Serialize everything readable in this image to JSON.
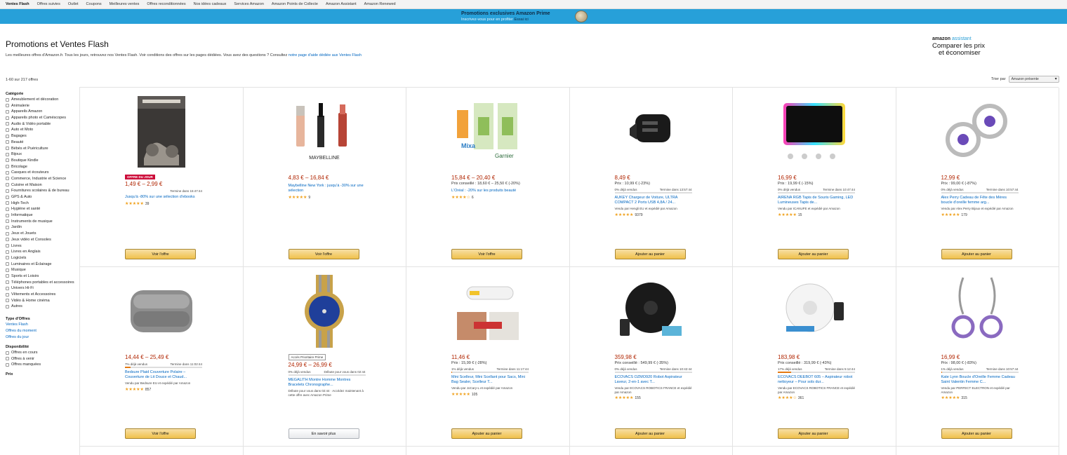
{
  "nav": {
    "items": [
      "Ventes Flash",
      "Offres suivies",
      "Outlet",
      "Coupons",
      "Meilleures ventes",
      "Offres reconditionnées",
      "Nos idées cadeaux",
      "Services Amazon",
      "Amazon Points de Collecte",
      "Amazon Assistant",
      "Amazon Renewed"
    ],
    "active_index": 0
  },
  "banner": {
    "title": "Promotions exclusives Amazon Prime",
    "subtitle": "Inscrivez-vous pour en profiter",
    "subtitle_link": "Essai ici",
    "bg_color": "#27a0d9"
  },
  "header": {
    "title": "Promotions et Ventes Flash",
    "description": "Les meilleures offres d'Amazon.fr. Tous les jours, retrouvez nos Ventes Flash. Voir conditions des offres sur les pages dédiées. Vous avez des questions ? Consultez",
    "description_link": "notre page d'aide dédiée aux Ventes Flash"
  },
  "assistant": {
    "logo_prefix": "amazon",
    "logo_suffix": "assistant",
    "line1": "Comparer les prix",
    "line2": "et économiser"
  },
  "results": {
    "count": "1-60 sur 217 offres"
  },
  "sort": {
    "label": "Trier par",
    "selected": "Amazon présente"
  },
  "sidebar": {
    "category_title": "Catégorie",
    "categories": [
      "Ameublement et décoration",
      "Animalerie",
      "Appareils Amazon",
      "Appareils photo et Caméscopes",
      "Audio & Vidéo portable",
      "Auto et Moto",
      "Bagages",
      "Beauté",
      "Bébés et Puériculture",
      "Bijoux",
      "Boutique Kindle",
      "Bricolage",
      "Casques et écouteurs",
      "Commerce, Industrie et Science",
      "Cuisine et Maison",
      "Fournitures scolaires & de bureau",
      "GPS & Auto",
      "High-Tech",
      "Hygiène et santé",
      "Informatique",
      "Instruments de musique",
      "Jardin",
      "Jeux et Jouets",
      "Jeux vidéo et Consoles",
      "Livres",
      "Livres en Anglais",
      "Logiciels",
      "Luminaires et Éclairage",
      "Musique",
      "Sports et Loisirs",
      "Téléphones portables et accessoires",
      "Univers Hi-Fi",
      "Vêtements et Accessoires",
      "Vidéo & Home cinéma",
      "Autres"
    ],
    "type_title": "Type d'Offres",
    "types": [
      "Ventes Flash",
      "Offres du moment",
      "Offres du jour"
    ],
    "availability_title": "Disponibilité",
    "availability": [
      "Offres en cours",
      "Offres à venir",
      "Offres manquées"
    ],
    "price_title": "Prix"
  },
  "products": [
    {
      "badge": "OFFRE DU JOUR",
      "price": "1,49 € – 2,99 €",
      "ref": "",
      "meta_left": "",
      "meta_right": "Termine dans 15:47:44",
      "claimed": null,
      "title": "Jusqu'à -80% sur une sélection d'ebooks",
      "seller": "",
      "stars": "★★★★★",
      "reviews": "39",
      "button": "Voir l'offre",
      "button_style": "yellow",
      "image": "book-icon"
    },
    {
      "badge": "",
      "price": "4,83 € – 16,84 €",
      "ref": "",
      "meta_left": "",
      "meta_right": "",
      "claimed": null,
      "title": "Maybelline New York : jusqu'à -30% sur une sélection",
      "seller": "",
      "stars": "★★★★★",
      "reviews": "9",
      "button": "Voir l'offre",
      "button_style": "yellow",
      "image": "makeup-icon"
    },
    {
      "badge": "",
      "price": "15,84 € – 20,40 €",
      "ref": "Prix conseillé : 18,60 € – 25,50 € (-20%)",
      "meta_left": "",
      "meta_right": "",
      "claimed": null,
      "title": "L'Oréal : -20% sur les produits beauté",
      "seller": "",
      "stars": "★★★★☆",
      "reviews": "6",
      "button": "Voir l'offre",
      "button_style": "yellow",
      "image": "cosmetics-icon"
    },
    {
      "badge": "",
      "price": "8,49 €",
      "ref": "Prix : 10,99 € (-23%)",
      "meta_left": "0% déjà vendus",
      "meta_right": "Termine dans 13:57:44",
      "claimed": 0,
      "title": "AUKEY Chargeur de Voiture, ULTRA COMPACT 2 Ports USB 4,8A / 24...",
      "seller": "Vendu par Hengli EU et expédié par Amazon",
      "stars": "★★★★★",
      "reviews": "9379",
      "button": "Ajouter au panier",
      "button_style": "yellow",
      "image": "car-charger-icon"
    },
    {
      "badge": "",
      "price": "16,99 €",
      "ref": "Prix : 19,99 € (-15%)",
      "meta_left": "0% déjà vendus",
      "meta_right": "Termine dans 10:47:44",
      "claimed": 0,
      "title": "AIRENA RGB Tapis de Souris Gaming, LED Lumineuses Tapis de...",
      "seller": "Vendu par ICANUFE et expédié par Amazon",
      "stars": "★★★★★",
      "reviews": "15",
      "button": "Ajouter au panier",
      "button_style": "yellow",
      "image": "mousepad-icon"
    },
    {
      "badge": "",
      "price": "12,99 €",
      "ref": "Prix : 99,00 € (-87%)",
      "meta_left": "0% déjà vendus",
      "meta_right": "Termine dans 10:57:44",
      "claimed": 0,
      "title": "Alex Perry Cadeau de Fête des Mères boucle d'oreille femme arg...",
      "seller": "Vendu par Alex Perry Bijoux et expédié par Amazon",
      "stars": "★★★★★",
      "reviews": "179",
      "button": "Ajouter au panier",
      "button_style": "yellow",
      "image": "earrings-icon"
    },
    {
      "badge": "",
      "price": "14,44 € – 25,49 €",
      "ref": "",
      "meta_left": "7% déjà vendus",
      "meta_right": "Termine dans 11:02:44",
      "claimed": 7,
      "title": "Bedsure Plaid Couverture Polaire – Couverture de Lit Douce et Chaud...",
      "seller": "Vendu par Bedsure EU et expédié par Amazon",
      "stars": "★★★★★",
      "reviews": "857",
      "button": "Voir l'offre",
      "button_style": "yellow",
      "image": "blanket-icon"
    },
    {
      "badge": "Accès Prioritaire Prime",
      "price": "24,99 € – 26,99 €",
      "ref": "",
      "meta_left": "0% déjà vendus",
      "meta_right": "Débute pour vous dans 02:44",
      "claimed": 0,
      "title": "MEGALITH Montre Homme Montres Bracelets Chronographe...",
      "seller": "Débute pour vous dans 02:44 · Accédez maintenant à cette offre avec Amazon Prime",
      "stars": "",
      "reviews": "",
      "button": "En savoir plus",
      "button_style": "white",
      "image": "watch-icon"
    },
    {
      "badge": "",
      "price": "11,46 €",
      "ref": "Prix : 15,99 € (-28%)",
      "meta_left": "1% déjà vendus",
      "meta_right": "Termine dans 11:17:44",
      "claimed": 1,
      "title": "Mini Scelleur, Mini Scellant pour Sacs, Mini Bag Sealer, Scelleur T...",
      "seller": "Vendu par JoCary-L et expédié par Amazon",
      "stars": "★★★★★",
      "reviews": "105",
      "button": "Ajouter au panier",
      "button_style": "yellow",
      "image": "sealer-icon"
    },
    {
      "badge": "",
      "price": "359,98 €",
      "ref": "Prix conseillé : 549,99 € (-35%)",
      "meta_left": "0% déjà vendus",
      "meta_right": "Termine dans 10:42:44",
      "claimed": 0,
      "title": "ECOVACS OZMO920 Robot Aspirateur Laveur, 2-en-1 avec T...",
      "seller": "Vendu par ECOVACS ROBOTICS FRANCE et expédié par Amazon",
      "stars": "★★★★★",
      "reviews": "155",
      "button": "Ajouter au panier",
      "button_style": "yellow",
      "image": "robot-vacuum-icon"
    },
    {
      "badge": "",
      "price": "183,98 €",
      "ref": "Prix conseillé : 319,99 € (-43%)",
      "meta_left": "17% déjà vendus",
      "meta_right": "Termine dans 5:12:44",
      "claimed": 17,
      "title": "ECOVACS DEEBOT 605 – Aspirateur robot nettoyeur – Pour sols dur...",
      "seller": "Vendu par ECOVACS ROBOTICS FRANCE et expédié par Amazon",
      "stars": "★★★★☆",
      "reviews": "361",
      "button": "Ajouter au panier",
      "button_style": "yellow",
      "image": "robot-vacuum-white-icon"
    },
    {
      "badge": "",
      "price": "16,99 €",
      "ref": "Prix : 98,00 € (-83%)",
      "meta_left": "1% déjà vendus",
      "meta_right": "Termine dans 10:57:44",
      "claimed": 1,
      "title": "Kate Lynn Boucle d'Oreille Femme Cadeau Saint Valentin Femme C...",
      "seller": "Vendu par PERFECT ELECTRON et expédié par Amazon",
      "stars": "★★★★★",
      "reviews": "315",
      "button": "Ajouter au panier",
      "button_style": "yellow",
      "image": "drop-earrings-icon"
    }
  ]
}
